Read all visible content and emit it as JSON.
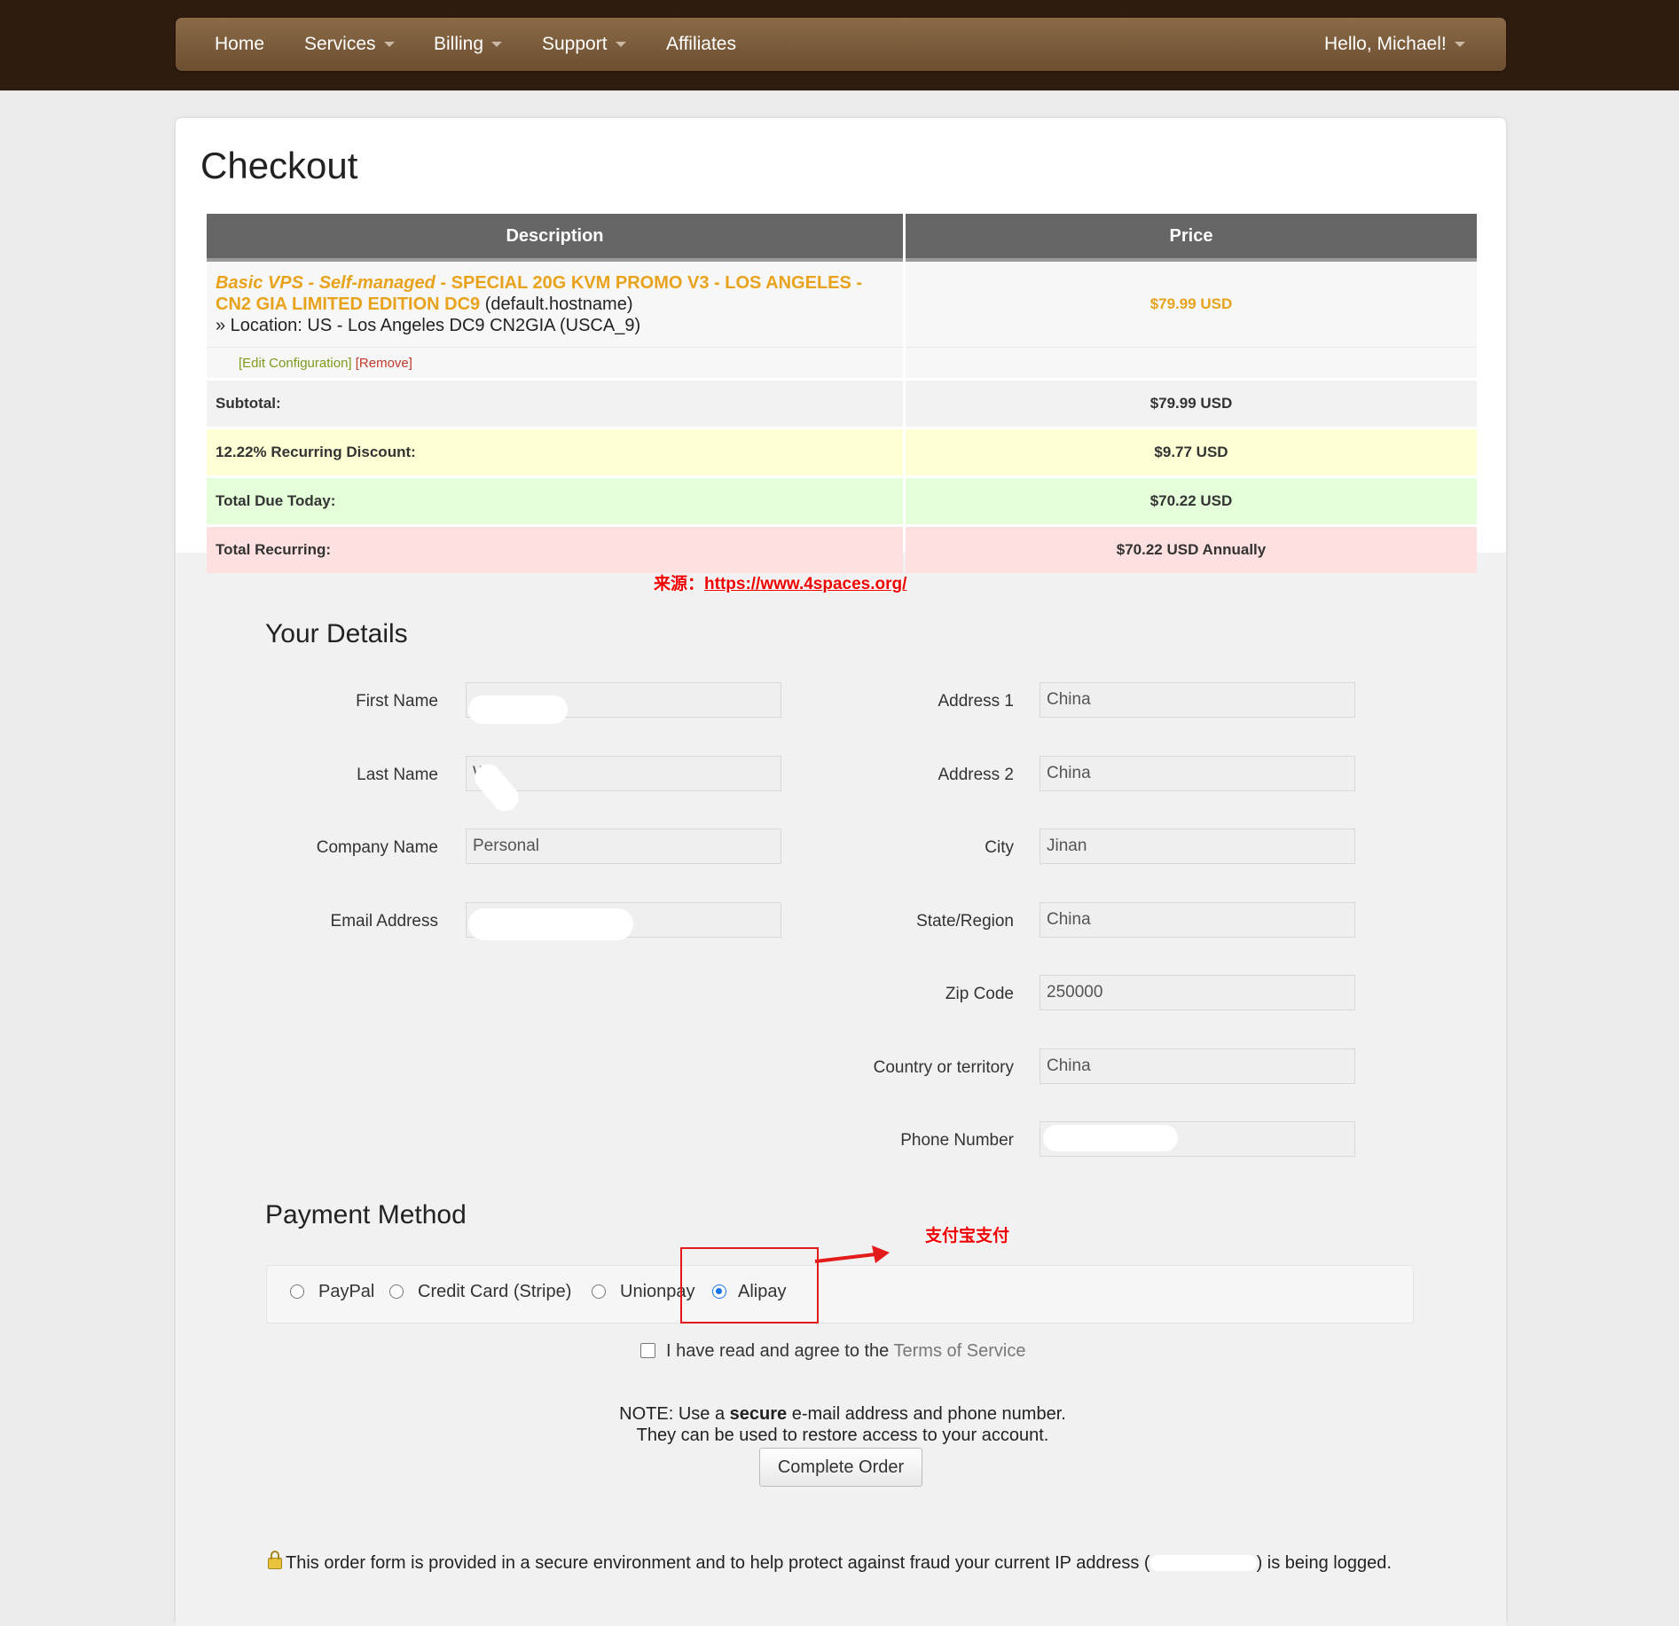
{
  "nav": {
    "home": "Home",
    "services": "Services",
    "billing": "Billing",
    "support": "Support",
    "affiliates": "Affiliates",
    "user": "Hello, Michael!"
  },
  "page_title": "Checkout",
  "cart": {
    "col_description": "Description",
    "col_price": "Price",
    "product_group": "Basic VPS - Self-managed",
    "product_name": " - SPECIAL 20G KVM PROMO V3 - LOS ANGELES - CN2 GIA LIMITED EDITION DC9",
    "hostname": "(default.hostname)",
    "location": "» Location: US - Los Angeles DC9 CN2GIA (USCA_9)",
    "price": "$79.99 USD",
    "edit_label": "[Edit Configuration]",
    "remove_label": "[Remove]",
    "subtotal_label": "Subtotal:",
    "subtotal_value": "$79.99 USD",
    "discount_label": "12.22% Recurring Discount:",
    "discount_value": "$9.77 USD",
    "due_label": "Total Due Today:",
    "due_value": "$70.22 USD",
    "recurring_label": "Total Recurring:",
    "recurring_value": "$70.22 USD Annually"
  },
  "watermark": {
    "prefix": "来源：",
    "url": "https://www.4spaces.org/"
  },
  "details": {
    "heading": "Your Details",
    "first_name_label": "First Name",
    "first_name_value": "",
    "last_name_label": "Last Name",
    "last_name_value": "W",
    "company_label": "Company Name",
    "company_value": "Personal",
    "email_label": "Email Address",
    "email_value": "",
    "address1_label": "Address 1",
    "address1_value": "China",
    "address2_label": "Address 2",
    "address2_value": "China",
    "city_label": "City",
    "city_value": "Jinan",
    "state_label": "State/Region",
    "state_value": "China",
    "zip_label": "Zip Code",
    "zip_value": "250000",
    "country_label": "Country or territory",
    "country_value": "China",
    "phone_label": "Phone Number",
    "phone_value": ""
  },
  "payment": {
    "heading": "Payment Method",
    "options": [
      "PayPal",
      "Credit Card (Stripe)",
      "Unionpay",
      "Alipay"
    ],
    "selected": "Alipay",
    "annotation": "支付宝支付"
  },
  "tos": {
    "prefix": "I have read and agree to the",
    "link": "Terms of Service"
  },
  "note": {
    "line1_pre": "NOTE: Use a",
    "line1_bold": "secure",
    "line1_post": "e-mail address and phone number.",
    "line2": "They can be used to restore access to your account."
  },
  "complete_button": "Complete Order",
  "secure_notice": {
    "pre": "This order form is provided in a secure environment and to help protect against fraud your current IP address (",
    "post": ") is being logged."
  },
  "colors": {
    "topbar": "#2e1c0e",
    "nav": "#7a5a3a",
    "accent": "#e8a21b",
    "annotation_red": "#e41b1b",
    "radio_selected": "#1a73e8"
  }
}
